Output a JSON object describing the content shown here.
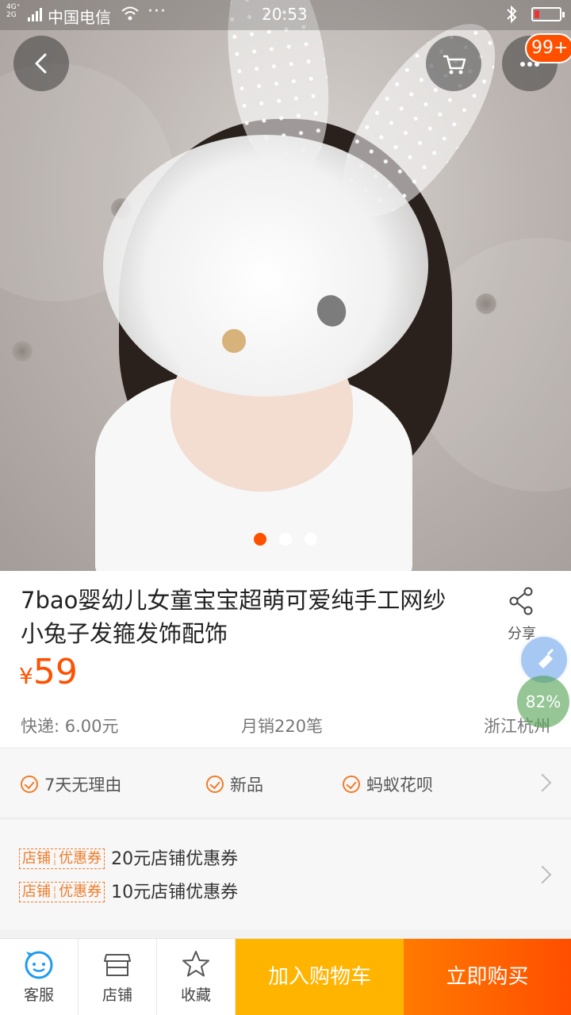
{
  "status_bar": {
    "network": "4G⁺\n2G",
    "carrier": "中国电信",
    "more": "···",
    "time": "20:53"
  },
  "header": {
    "cart_badge": "99+"
  },
  "gallery": {
    "current_page": 1,
    "page_count": 3
  },
  "product": {
    "title": "7bao婴幼儿女童宝宝超萌可爱纯手工网纱小兔子发箍发饰配饰",
    "share_label": "分享",
    "currency": "¥",
    "price": "59",
    "shipping": "快递: 6.00元",
    "monthly_sales": "月销220笔",
    "location": "浙江杭州"
  },
  "floating": {
    "percent": "82%"
  },
  "services": [
    {
      "label": "7天无理由"
    },
    {
      "label": "新品"
    },
    {
      "label": "蚂蚁花呗"
    }
  ],
  "coupons": [
    {
      "tag_left": "店铺",
      "tag_right": "优惠券",
      "text": "20元店铺优惠券"
    },
    {
      "tag_left": "店铺",
      "tag_right": "优惠券",
      "text": "10元店铺优惠券"
    }
  ],
  "bottom_bar": {
    "service_label": "客服",
    "shop_label": "店铺",
    "favorite_label": "收藏",
    "add_to_cart": "加入购物车",
    "buy_now": "立即购买"
  },
  "colors": {
    "accent": "#ff5000",
    "add_to_cart_bg": "#ffb400",
    "tag_orange": "#f07c2a"
  },
  "icons": [
    "back-arrow-icon",
    "cart-icon",
    "more-icon",
    "share-icon",
    "check-circle-icon",
    "chevron-right-icon",
    "smiley-chat-icon",
    "store-icon",
    "star-icon",
    "wifi-icon",
    "bluetooth-icon",
    "battery-icon"
  ]
}
